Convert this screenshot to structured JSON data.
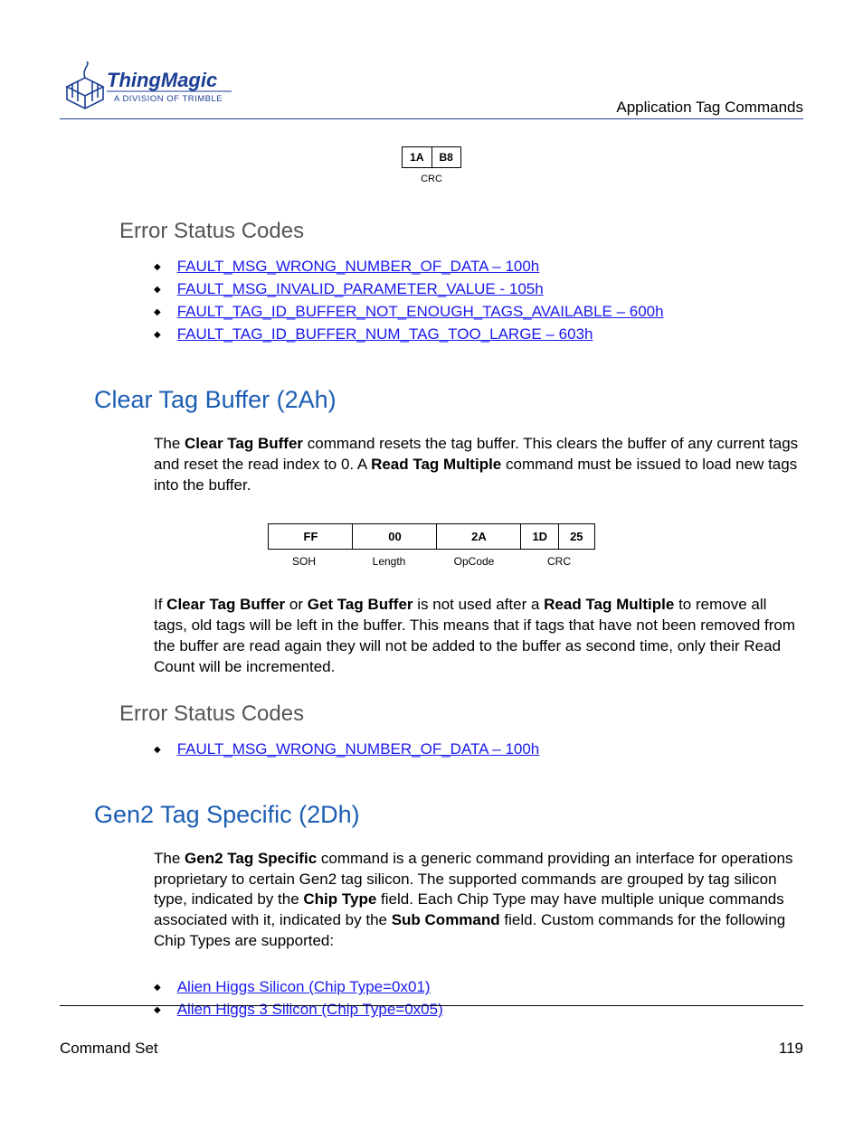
{
  "header": {
    "section_title": "Application Tag Commands",
    "logo_main": "ThingMagic",
    "logo_sub": "A DIVISION OF TRIMBLE"
  },
  "crc_box": {
    "c1": "1A",
    "c2": "B8",
    "label": "CRC"
  },
  "sec1": {
    "heading": "Error Status Codes",
    "links": [
      "FAULT_MSG_WRONG_NUMBER_OF_DATA – 100h",
      "FAULT_MSG_INVALID_PARAMETER_VALUE - 105h",
      "FAULT_TAG_ID_BUFFER_NOT_ENOUGH_TAGS_AVAILABLE – 600h",
      "FAULT_TAG_ID_BUFFER_NUM_TAG_TOO_LARGE – 603h"
    ]
  },
  "sec2": {
    "heading": "Clear Tag Buffer (2Ah)",
    "p1_a": "The ",
    "p1_b": "Clear Tag Buffer",
    "p1_c": " command resets the tag buffer. This clears the buffer of any current tags and reset the read index to 0. A ",
    "p1_d": "Read Tag Multiple",
    "p1_e": " command must be issued to load new tags into the buffer.",
    "tbl": {
      "c1": "FF",
      "c2": "00",
      "c3": "2A",
      "c4": "1D",
      "c5": "25",
      "l1": "SOH",
      "l2": "Length",
      "l3": "OpCode",
      "l4": "CRC"
    },
    "p2_a": "If ",
    "p2_b": "Clear Tag Buffer",
    "p2_c": " or ",
    "p2_d": "Get Tag Buffer",
    "p2_e": " is not used after a ",
    "p2_f": "Read Tag Multiple",
    "p2_g": " to remove all tags, old tags will be left in the buffer. This means that if tags that have not been removed from the buffer are read again they will not be added to the buffer as second time, only their Read Count will be incremented."
  },
  "sec3": {
    "heading": "Error Status Codes",
    "links": [
      "FAULT_MSG_WRONG_NUMBER_OF_DATA – 100h"
    ]
  },
  "sec4": {
    "heading": "Gen2 Tag Specific (2Dh)",
    "p1_a": "The ",
    "p1_b": "Gen2 Tag Specific",
    "p1_c": " command is a generic command providing an interface for operations proprietary to certain Gen2 tag silicon. The supported commands are grouped by tag silicon type, indicated by the ",
    "p1_d": "Chip Type",
    "p1_e": " field. Each Chip Type may have multiple unique commands associated with it, indicated by the ",
    "p1_f": "Sub Command",
    "p1_g": " field. Custom commands for the following Chip Types are supported:",
    "links": [
      "Alien Higgs Silicon (Chip Type=0x01)",
      "Alien Higgs 3 Silicon (Chip Type=0x05)"
    ]
  },
  "footer": {
    "left": "Command Set",
    "right": "119"
  }
}
